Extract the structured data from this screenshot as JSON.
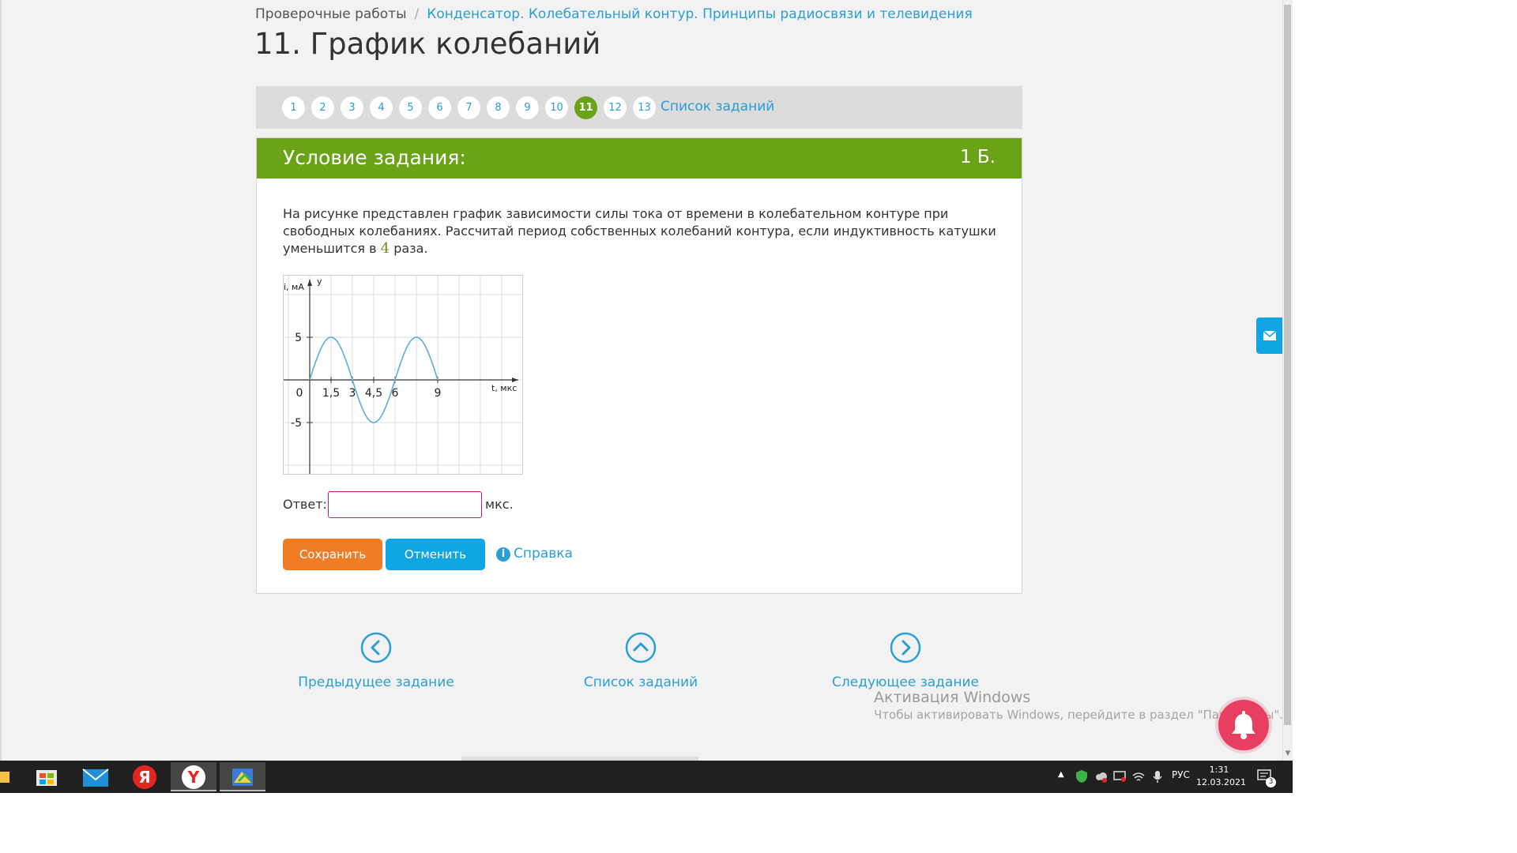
{
  "breadcrumb": {
    "root": "Проверочные работы",
    "separator": "/",
    "topic": "Конденсатор. Колебательный контур. Принципы радиосвязи и телевидения"
  },
  "page_title": "11. График колебаний",
  "pager": {
    "pages": [
      "1",
      "2",
      "3",
      "4",
      "5",
      "6",
      "7",
      "8",
      "9",
      "10",
      "11",
      "12",
      "13"
    ],
    "active": "11",
    "list_link": "Список заданий"
  },
  "task": {
    "header": "Условие задания:",
    "points": "1 Б.",
    "text_before": "На рисунке представлен график зависимости силы тока от времени в колебательном контуре при свободных колебаниях. Рассчитай период собственных колебаний контура, если индуктивность катушки уменьшится в ",
    "factor": "4",
    "text_after": " раза.",
    "answer_label": "Ответ:",
    "answer_value": "",
    "answer_unit": "мкс.",
    "save_button": "Сохранить",
    "cancel_button": "Отменить",
    "help_link": "Справка"
  },
  "chart_data": {
    "type": "line",
    "xlabel": "t, мкс",
    "ylabel": "i, мА",
    "y_axis_name": "y",
    "x_ticks": [
      "0",
      "1,5",
      "3",
      "4,5",
      "6",
      "9"
    ],
    "y_ticks": [
      "5",
      "-5"
    ],
    "xlim": [
      0,
      12
    ],
    "ylim": [
      -7.5,
      10
    ],
    "grid": true,
    "series": [
      {
        "function": "5*sin(2*pi*t/6)",
        "x": [
          0,
          1.5,
          3,
          4.5,
          6,
          7.5,
          9
        ],
        "y": [
          0,
          5,
          0,
          -5,
          0,
          5,
          0
        ]
      }
    ]
  },
  "bottom_nav": {
    "prev": "Предыдущее задание",
    "list": "Список заданий",
    "next": "Следующее задание"
  },
  "watermark": {
    "title": "Активация Windows",
    "subtitle": "Чтобы активировать Windows, перейдите в раздел \"Параметры\"."
  },
  "taskbar": {
    "apps": [
      "file-explorer",
      "store",
      "mail",
      "yandex",
      "yandex-browser",
      "task-app"
    ],
    "language": "РУС",
    "time": "1:31",
    "date": "12.03.2021",
    "notifications": "3"
  },
  "colors": {
    "green": "#6aa218",
    "link": "#2a9fd6",
    "save": "#f07d26",
    "cancel": "#10a5e5",
    "curve": "#5aaee0"
  }
}
